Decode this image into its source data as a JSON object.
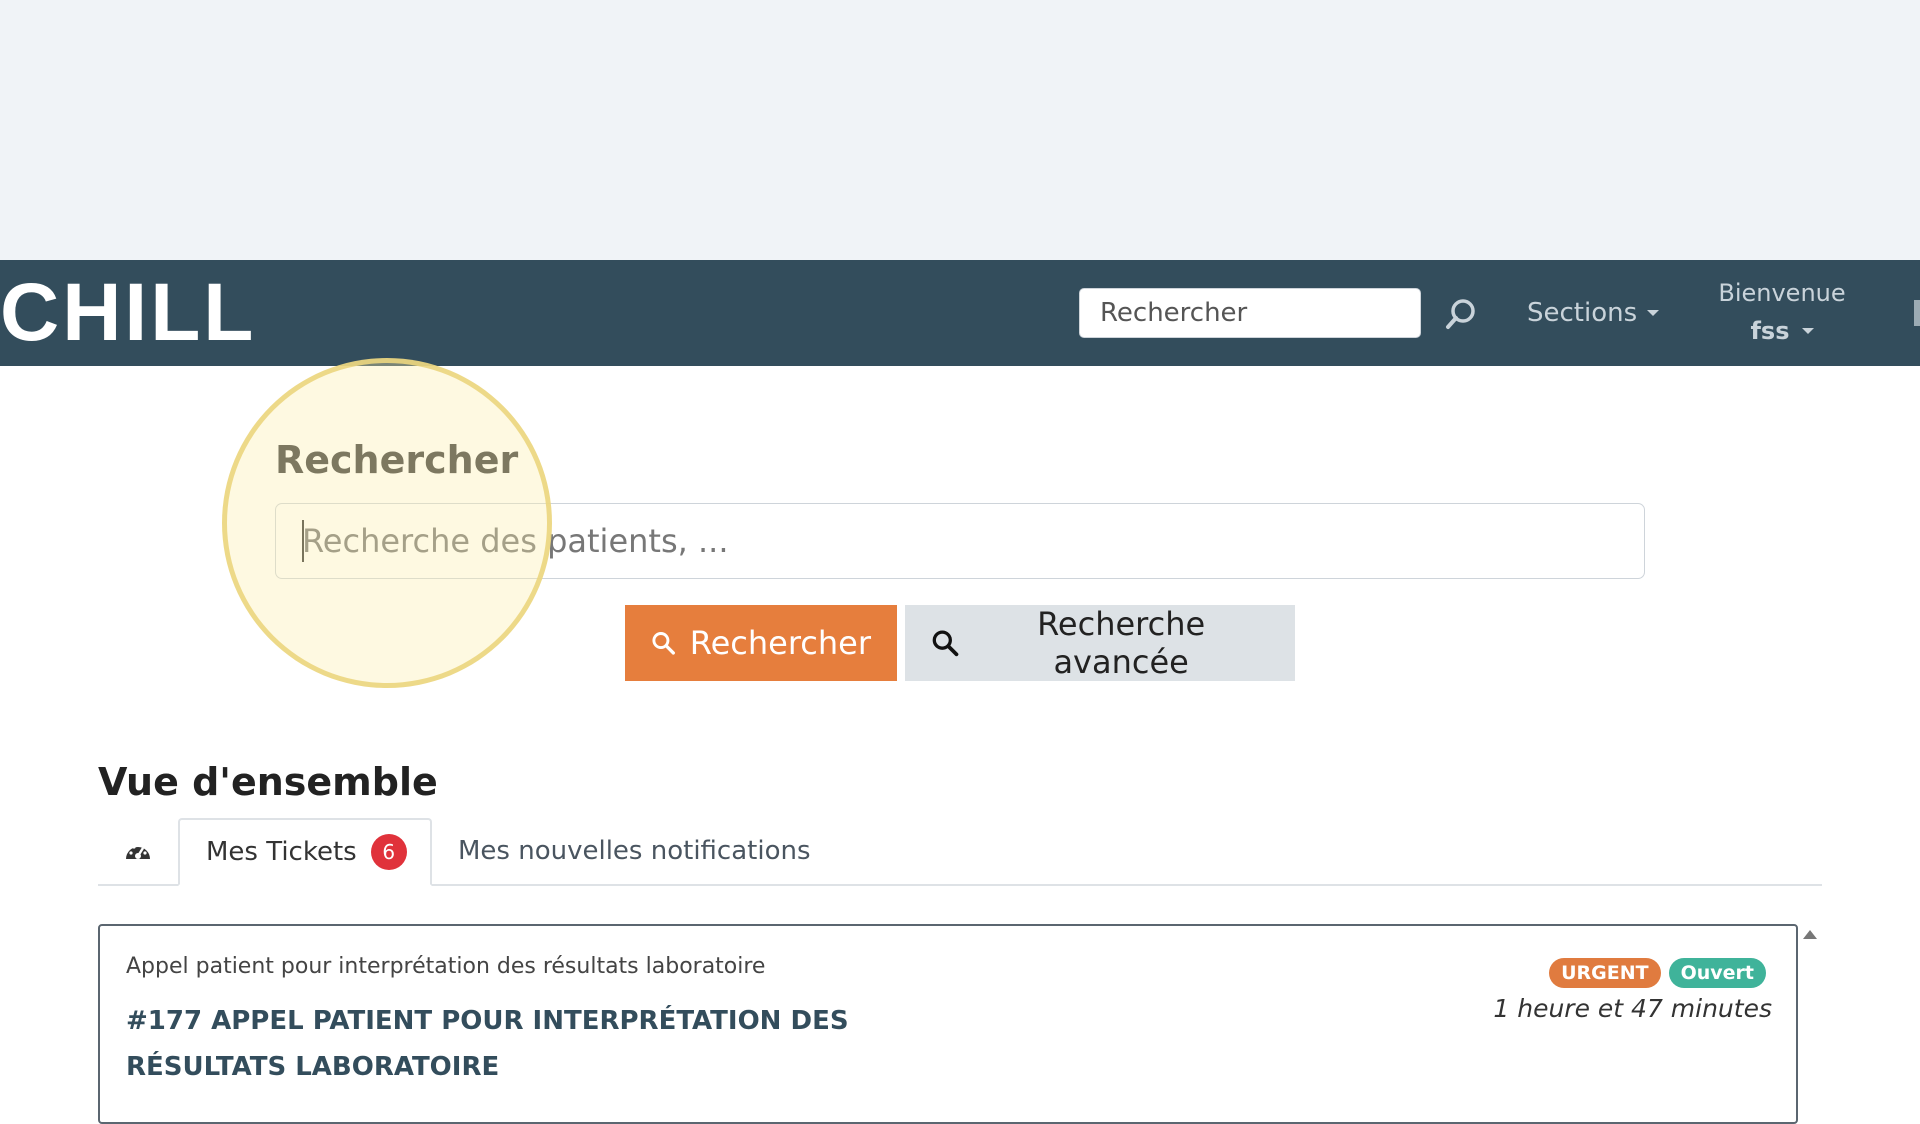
{
  "navbar": {
    "brand": "CHILL",
    "search_placeholder": "Rechercher",
    "sections_label": "Sections",
    "welcome_label": "Bienvenue",
    "username": "fss"
  },
  "search": {
    "title": "Rechercher",
    "placeholder": "Recherche des patients, ...",
    "submit_label": "Rechercher",
    "advanced_label": "Recherche avancée"
  },
  "overview": {
    "title": "Vue d'ensemble",
    "tabs": [
      {
        "icon": "dashboard-icon"
      },
      {
        "label": "Mes Tickets",
        "count": "6"
      },
      {
        "label": "Mes nouvelles notifications"
      }
    ]
  },
  "ticket": {
    "subtitle": "Appel patient pour interprétation des résultats laboratoire",
    "title": "#177 APPEL PATIENT POUR INTERPRÉTATION DES RÉSULTATS LABORATOIRE",
    "badge_priority": "URGENT",
    "badge_status": "Ouvert",
    "elapsed": "1 heure et 47 minutes"
  },
  "colors": {
    "navbar_bg": "#334d5c",
    "primary_button": "#e67e3d",
    "urgent_badge": "#e07b3f",
    "open_badge": "#3fb39a",
    "count_badge": "#e0323b"
  }
}
